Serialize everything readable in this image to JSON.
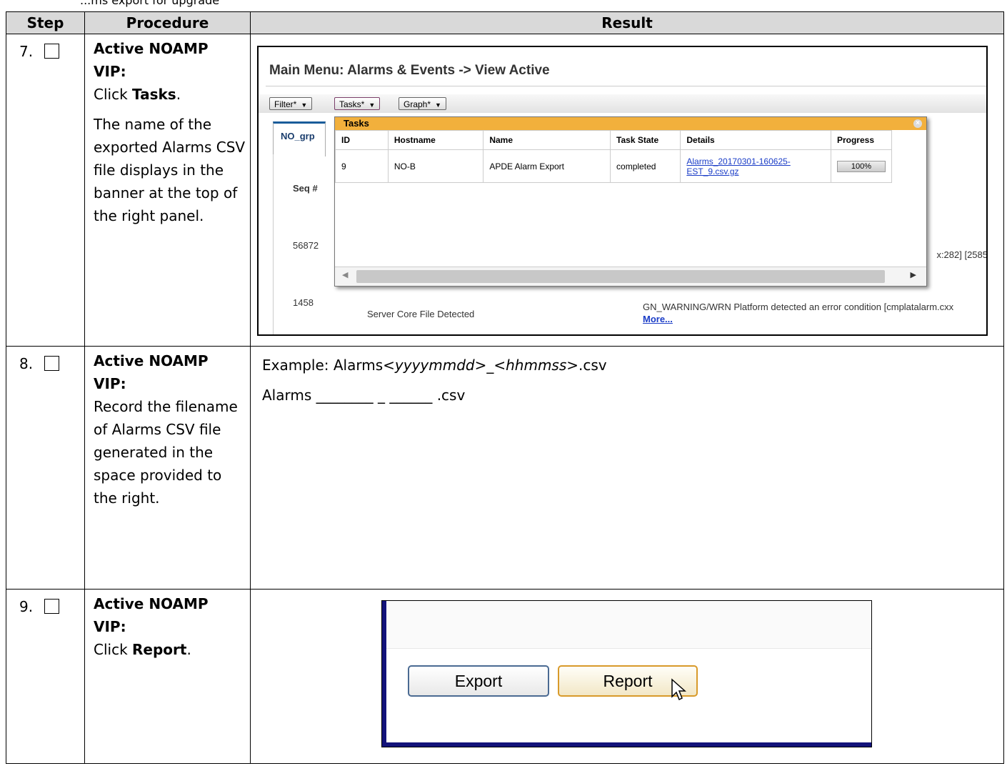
{
  "header_cutoff": "...ms export for upgrade",
  "table": {
    "headers": [
      "Step",
      "Procedure",
      "Result"
    ],
    "rows": [
      {
        "step": "7.",
        "procedure": {
          "bold": "Active NOAMP VIP:",
          "action_prefix": "Click ",
          "action_bold": "Tasks",
          "action_suffix": ".",
          "note": "The name of the exported Alarms CSV file displays in the banner at the top of the right panel."
        }
      },
      {
        "step": "8.",
        "procedure": {
          "bold": "Active NOAMP VIP:",
          "text": "Record the filename of Alarms CSV file generated in the space provided to the right."
        },
        "result": {
          "example_prefix": "Example: Alarms",
          "example_italic1": "<yyyymmdd>",
          "example_mid": "_",
          "example_italic2": "<hhmmss>",
          "example_suffix": ".csv",
          "record_line": "Alarms ________ _ ______ .csv"
        }
      },
      {
        "step": "9.",
        "procedure": {
          "bold": "Active NOAMP VIP:",
          "action_prefix": "Click ",
          "action_bold": "Report",
          "action_suffix": "."
        }
      }
    ]
  },
  "screenshot1": {
    "title": "Main Menu: Alarms & Events -> View Active",
    "toolbar": [
      "Filter*",
      "Tasks*",
      "Graph*"
    ],
    "tab": "NO_grp",
    "bg_seq_header": "Seq #",
    "bg_rows": [
      "56872",
      "1458"
    ],
    "bg_event": "Server Core File Detected",
    "bg_text_right": "x:282] [2585",
    "bg_text_bottom": "GN_WARNING/WRN Platform detected an error condition [cmplatalarm.cxx",
    "more_link": "More...",
    "popup": {
      "title": "Tasks",
      "columns": [
        "ID",
        "Hostname",
        "Name",
        "Task State",
        "Details",
        "Progress"
      ],
      "row": {
        "id": "9",
        "hostname": "NO-B",
        "name": "APDE Alarm Export",
        "state": "completed",
        "details_line1": "Alarms_20170301-160625-",
        "details_line2": "EST_9.csv.gz",
        "progress": "100%"
      }
    }
  },
  "screenshot3": {
    "export_label": "Export",
    "report_label": "Report"
  },
  "colors": {
    "header_bg": "#d9d9d9",
    "popup_title": "#f2b03c",
    "link": "#1a3cc7",
    "frame_blue": "#13137a"
  }
}
